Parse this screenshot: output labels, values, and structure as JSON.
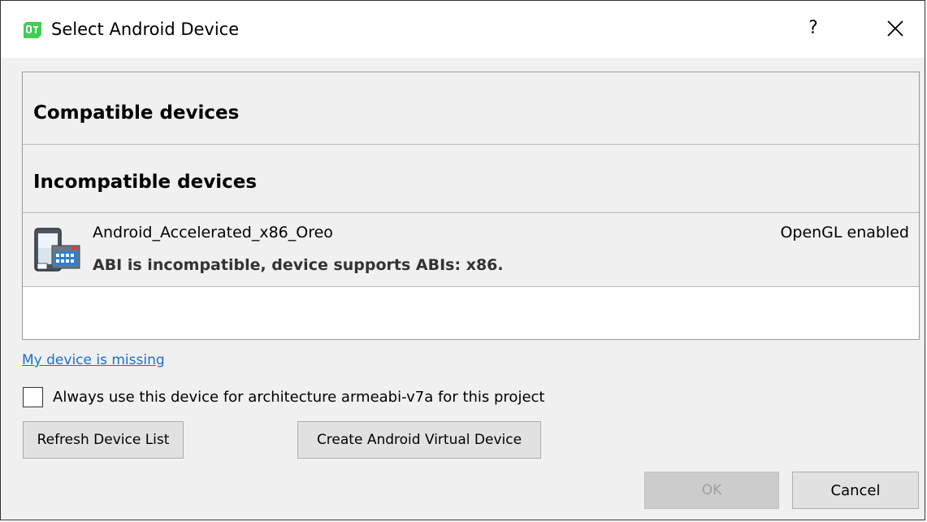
{
  "window": {
    "title": "Select Android Device",
    "help_label": "?",
    "icon": "qt-creator-icon",
    "close_icon": "close-icon"
  },
  "device_list": {
    "groups": [
      {
        "label": "Compatible devices"
      },
      {
        "label": "Incompatible devices"
      }
    ],
    "devices": [
      {
        "name": "Android_Accelerated_x86_Oreo",
        "status": "OpenGL enabled",
        "message": "ABI is incompatible, device supports ABIs: x86.",
        "icon": "emulator-device-icon"
      }
    ]
  },
  "missing_link": "My device is missing",
  "always_use": {
    "label": "Always use this device for architecture armeabi-v7a for this project",
    "checked": false
  },
  "buttons": {
    "refresh": "Refresh Device List",
    "create_avd": "Create Android Virtual Device",
    "ok": "OK",
    "cancel": "Cancel"
  },
  "colors": {
    "link": "#1a6fc9",
    "dialog_bg": "#f0f0f0",
    "disabled_text": "#9e9e9e"
  }
}
